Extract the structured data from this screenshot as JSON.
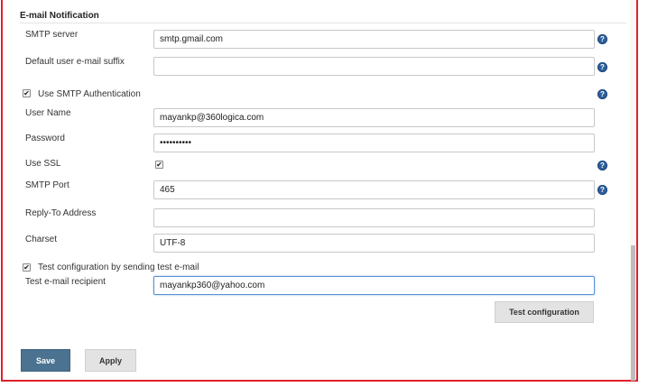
{
  "section": {
    "title": "E-mail Notification"
  },
  "fields": {
    "smtp_server": {
      "label": "SMTP server",
      "value": "smtp.gmail.com"
    },
    "default_suffix": {
      "label": "Default user e-mail suffix",
      "value": ""
    },
    "use_smtp_auth": {
      "label": "Use SMTP Authentication",
      "checked": true
    },
    "user_name": {
      "label": "User Name",
      "value": "mayankp@360logica.com"
    },
    "password": {
      "label": "Password",
      "value": "••••••••••"
    },
    "use_ssl": {
      "label": "Use SSL",
      "checked": true
    },
    "smtp_port": {
      "label": "SMTP Port",
      "value": "465"
    },
    "reply_to": {
      "label": "Reply-To Address",
      "value": ""
    },
    "charset": {
      "label": "Charset",
      "value": "UTF-8"
    },
    "test_config": {
      "label": "Test configuration by sending test e-mail",
      "checked": true
    },
    "test_recipient": {
      "label": "Test e-mail recipient",
      "value": "mayankp360@yahoo.com"
    }
  },
  "buttons": {
    "test_configuration": "Test configuration",
    "save": "Save",
    "apply": "Apply"
  },
  "icons": {
    "help": "?",
    "check": "✔"
  },
  "colors": {
    "accent": "#4b7391",
    "help": "#2f5f9a",
    "frame": "#e0202a"
  }
}
